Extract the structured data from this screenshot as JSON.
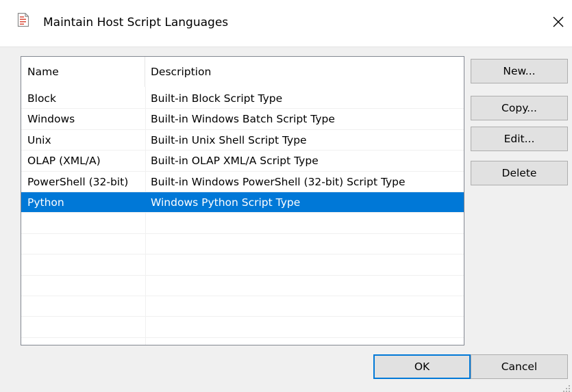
{
  "window": {
    "title": "Maintain Host Script Languages",
    "close_glyph": "✕",
    "icon": "script-document-icon"
  },
  "list": {
    "columns": [
      "Name",
      "Description"
    ],
    "rows": [
      {
        "name": "Block",
        "description": "Built-in Block Script Type",
        "selected": false
      },
      {
        "name": "Windows",
        "description": "Built-in Windows Batch Script Type",
        "selected": false
      },
      {
        "name": "Unix",
        "description": "Built-in Unix Shell Script Type",
        "selected": false
      },
      {
        "name": "OLAP (XML/A)",
        "description": "Built-in OLAP XML/A Script Type",
        "selected": false
      },
      {
        "name": "PowerShell (32-bit)",
        "description": "Built-in Windows PowerShell (32-bit) Script Type",
        "selected": false
      },
      {
        "name": "Python",
        "description": "Windows Python Script Type",
        "selected": true
      }
    ],
    "selection_color": "#0078d7"
  },
  "side_buttons": {
    "new": "New...",
    "copy": "Copy...",
    "edit": "Edit...",
    "delete": "Delete"
  },
  "footer_buttons": {
    "ok": "OK",
    "cancel": "Cancel"
  }
}
